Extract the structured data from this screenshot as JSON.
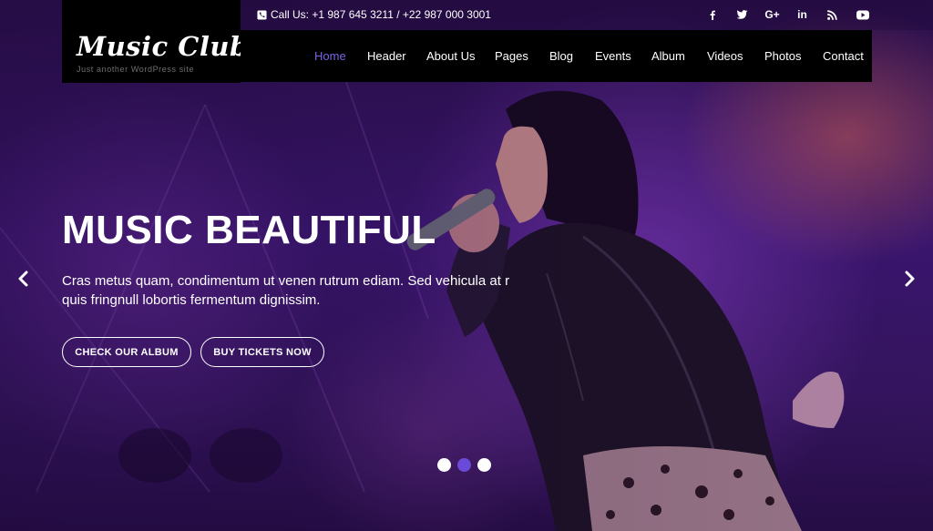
{
  "brand": {
    "logo": "Music Club",
    "tagline": "Just another WordPress site"
  },
  "topbar": {
    "contact": "Call Us: +1 987 645 3211 / +22 987 000 3001",
    "phone_icon": "phone-icon"
  },
  "social": [
    {
      "name": "facebook-icon",
      "glyph": "f"
    },
    {
      "name": "twitter-icon",
      "glyph": "t"
    },
    {
      "name": "google-plus-icon",
      "glyph": "G+"
    },
    {
      "name": "linkedin-icon",
      "glyph": "in"
    },
    {
      "name": "rss-icon",
      "glyph": "rss"
    },
    {
      "name": "youtube-icon",
      "glyph": "yt"
    }
  ],
  "nav": {
    "items": [
      "Home",
      "Header",
      "About Us",
      "Pages",
      "Blog",
      "Events",
      "Album",
      "Videos",
      "Photos",
      "Contact"
    ],
    "active": "Home",
    "active_color": "#7b63e6"
  },
  "hero": {
    "title": "MUSIC BEAUTIFUL",
    "text": "Cras metus quam, condimentum ut venen rutrum ediam. Sed vehicula at r quis fringnull lobortis fermentum dignissim.",
    "buttons": {
      "album": "CHECK OUR ALBUM",
      "tickets": "BUY TICKETS NOW"
    }
  },
  "slider": {
    "slides": 3,
    "active_slide": 2,
    "active_dot_color": "#6a4ad8"
  }
}
